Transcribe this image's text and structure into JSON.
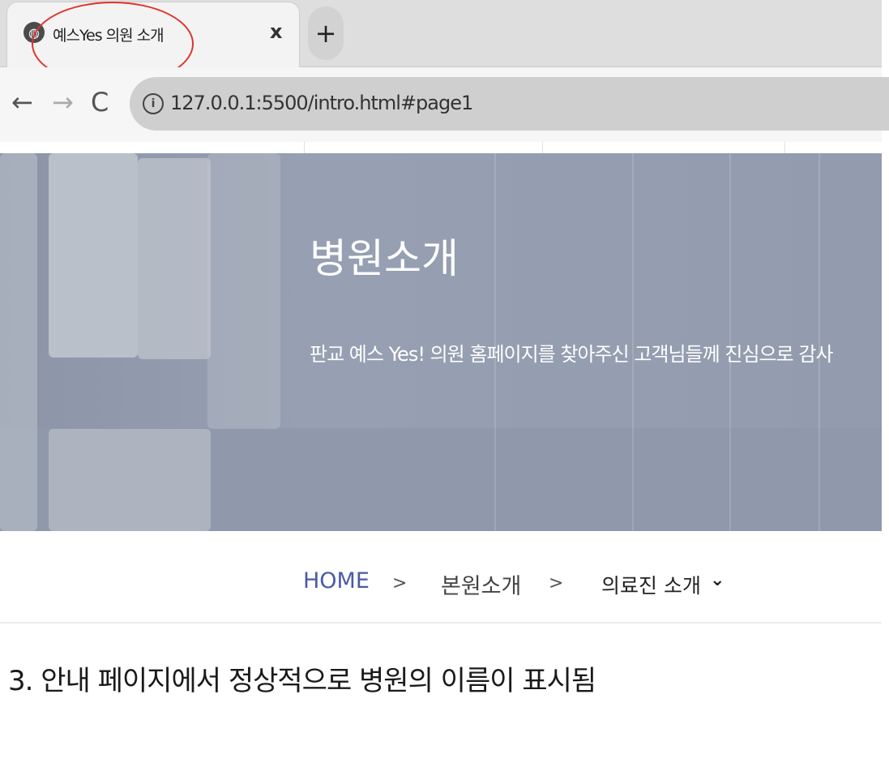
{
  "browser": {
    "tab": {
      "title": "예스Yes 의원 소개",
      "close_label": "x",
      "favicon": "globe-icon"
    },
    "new_tab_label": "+",
    "nav": {
      "back": "←",
      "forward": "→",
      "reload": "C"
    },
    "address": {
      "info_glyph": "i",
      "url": "127.0.0.1:5500/intro.html#page1"
    }
  },
  "hero": {
    "title": "병원소개",
    "subtitle": "판교 예스 Yes! 의원 홈페이지를 찾아주신 고객님들께 진심으로 감사"
  },
  "breadcrumb": {
    "home": "HOME",
    "separator": ">",
    "level2": "본원소개",
    "level3": "의료진 소개",
    "chevron": "⌄"
  },
  "note": "3. 안내 페이지에서 정상적으로 병원의 이름이 표시됨",
  "colors": {
    "annotation_oval": "#e0322e",
    "breadcrumb_home": "#4a5aa8",
    "hero_overlay": "#929cae"
  }
}
